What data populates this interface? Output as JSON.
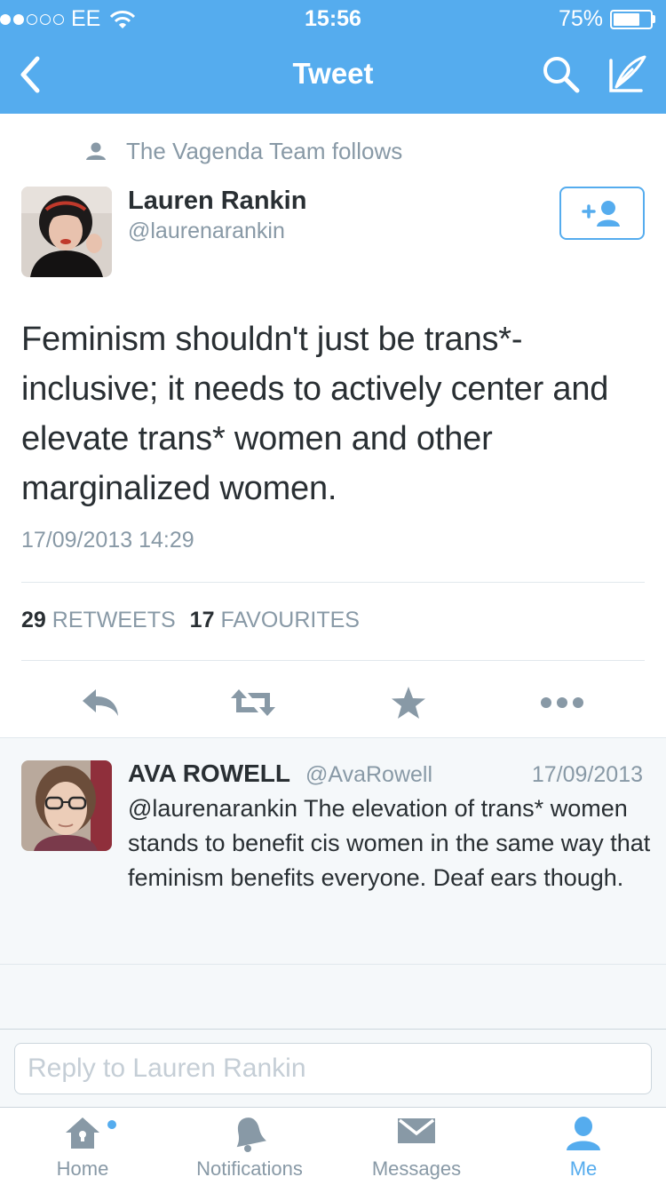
{
  "status_bar": {
    "carrier": "EE",
    "time": "15:56",
    "battery": "75%",
    "battery_level": 0.75,
    "signal_bars": 2
  },
  "nav": {
    "title": "Tweet"
  },
  "tweet": {
    "social_context": "The Vagenda Team follows",
    "author_name": "Lauren Rankin",
    "author_handle": "@laurenarankin",
    "text": "Feminism shouldn't just be trans*-inclusive; it needs to actively center and elevate trans* women and other marginalized women.",
    "date": "17/09/2013 14:29",
    "retweet_count": "29",
    "retweet_label": "RETWEETS",
    "favourite_count": "17",
    "favourite_label": "FAVOURITES"
  },
  "reply": {
    "author_name": "AVA ROWELL",
    "author_handle": "@AvaRowell",
    "date": "17/09/2013",
    "text": "@laurenarankin The elevation of trans* women stands to benefit cis women in the same way that feminism benefits everyone. Deaf ears though."
  },
  "composer": {
    "placeholder": "Reply to Lauren Rankin"
  },
  "tabs": [
    {
      "label": "Home",
      "icon": "home-icon",
      "has_notification": true,
      "active": false
    },
    {
      "label": "Notifications",
      "icon": "bell-icon",
      "active": false
    },
    {
      "label": "Messages",
      "icon": "envelope-icon",
      "active": false
    },
    {
      "label": "Me",
      "icon": "person-icon",
      "active": true
    }
  ],
  "colors": {
    "brand": "#55acee",
    "text": "#292f33",
    "muted": "#8899a6"
  }
}
